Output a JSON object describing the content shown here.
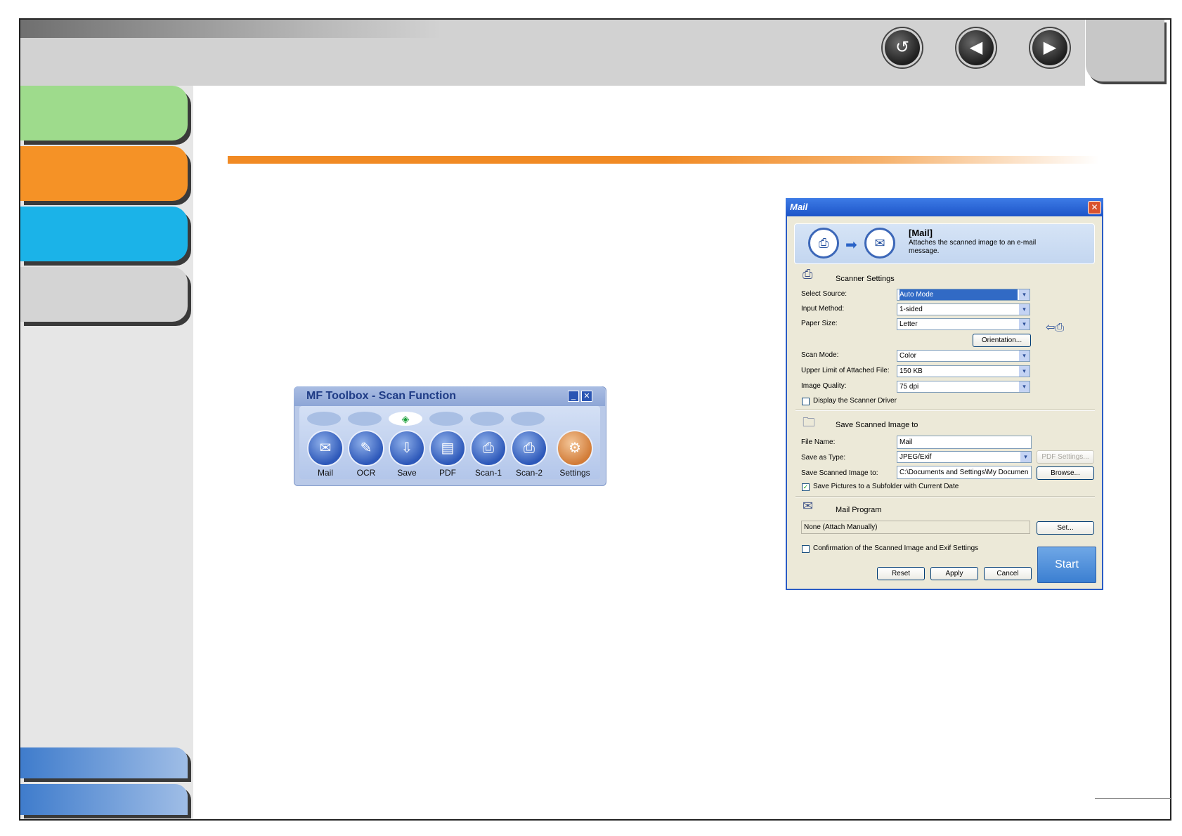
{
  "nav": {
    "return_glyph": "↺",
    "prev_glyph": "◀",
    "next_glyph": "▶"
  },
  "colors": {
    "tab_green": "#9edb8c",
    "tab_orange": "#f59226",
    "tab_cyan": "#1bb3e8",
    "tab_gray": "#d4d4d4",
    "accent_rule": "#f18a24"
  },
  "toolbox": {
    "title": "MF Toolbox - Scan Function",
    "minimize_glyph": "_",
    "close_glyph": "✕",
    "active_indicator": "◈",
    "buttons": [
      {
        "label": "Mail",
        "icon": "mail-icon",
        "glyph": "✉"
      },
      {
        "label": "OCR",
        "icon": "ocr-icon",
        "glyph": "✎"
      },
      {
        "label": "Save",
        "icon": "save-icon",
        "glyph": "⇩"
      },
      {
        "label": "PDF",
        "icon": "pdf-icon",
        "glyph": "▤"
      },
      {
        "label": "Scan-1",
        "icon": "scan1-icon",
        "glyph": "⎙"
      },
      {
        "label": "Scan-2",
        "icon": "scan2-icon",
        "glyph": "⎙"
      },
      {
        "label": "Settings",
        "icon": "settings-icon",
        "glyph": "⚙"
      }
    ]
  },
  "dialog": {
    "title": "Mail",
    "close_glyph": "✕",
    "banner": {
      "heading": "[Mail]",
      "description": "Attaches the scanned image to an e-mail message.",
      "scanner_glyph": "⎙",
      "arrow_glyph": "➡",
      "mail_glyph": "✉"
    },
    "scanner_settings": {
      "title": "Scanner Settings",
      "select_source_label": "Select Source:",
      "select_source_value": "Auto Mode",
      "input_method_label": "Input Method:",
      "input_method_value": "1-sided",
      "paper_size_label": "Paper Size:",
      "paper_size_value": "Letter",
      "orientation_button": "Orientation...",
      "scan_mode_label": "Scan Mode:",
      "scan_mode_value": "Color",
      "upper_limit_label": "Upper Limit of Attached File:",
      "upper_limit_value": "150 KB",
      "image_quality_label": "Image Quality:",
      "image_quality_value": "75 dpi",
      "display_driver_label": "Display the Scanner Driver",
      "display_driver_checked": false
    },
    "save_image": {
      "title": "Save Scanned Image to",
      "file_name_label": "File Name:",
      "file_name_value": "Mail",
      "save_type_label": "Save as Type:",
      "save_type_value": "JPEG/Exif",
      "pdf_settings_button": "PDF Settings...",
      "save_to_label": "Save Scanned Image to:",
      "save_to_value": "C:\\Documents and Settings\\My Documen",
      "browse_button": "Browse...",
      "subfolder_label": "Save Pictures to a Subfolder with Current Date",
      "subfolder_checked": true,
      "check_glyph": "✓"
    },
    "mail_program": {
      "title": "Mail Program",
      "value": "None (Attach Manually)",
      "set_button": "Set..."
    },
    "confirmation_label": "Confirmation of the Scanned Image and Exif Settings",
    "confirmation_checked": false,
    "reset_button": "Reset",
    "apply_button": "Apply",
    "cancel_button": "Cancel",
    "start_button": "Start",
    "dropdown_glyph": "▾"
  }
}
